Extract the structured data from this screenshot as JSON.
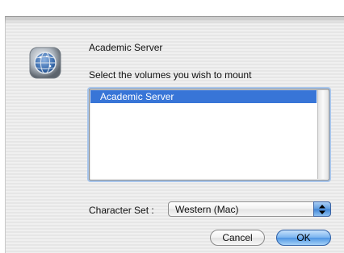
{
  "dialog": {
    "server_name": "Academic Server",
    "prompt": "Select the volumes you wish to mount",
    "icon": "network-server-globe-icon"
  },
  "volumes": {
    "items": [
      "Academic Server"
    ],
    "selected_index": 0
  },
  "charset": {
    "label": "Character Set :",
    "value": "Western (Mac)"
  },
  "buttons": {
    "cancel": "Cancel",
    "ok": "OK"
  },
  "colors": {
    "selection": "#3875d7",
    "default_button": "#4e95e3"
  }
}
